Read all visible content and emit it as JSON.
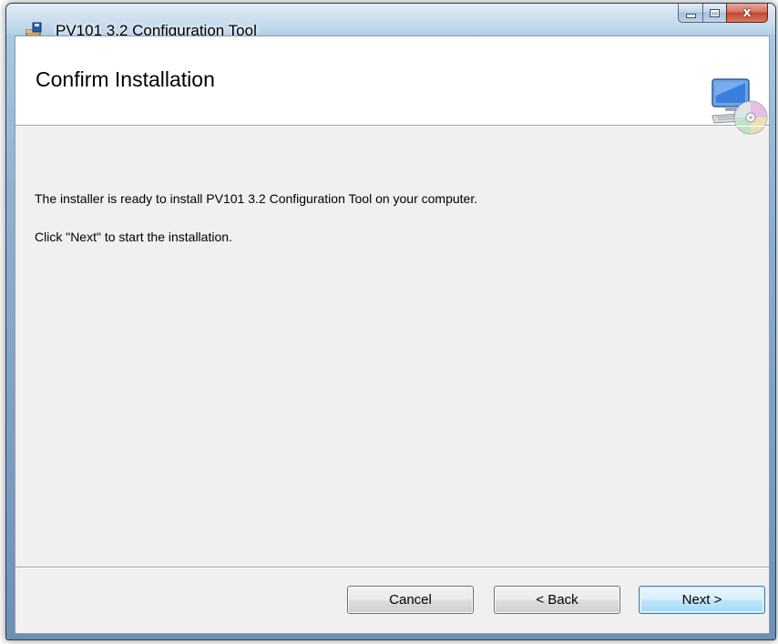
{
  "window": {
    "title": "PV101 3.2 Configuration Tool",
    "caption": {
      "minimize_icon": "minimize-icon",
      "maximize_icon": "maximize-icon",
      "close_glyph": "x"
    }
  },
  "banner": {
    "title": "Confirm Installation",
    "icon": "computer-cd-icon"
  },
  "content": {
    "line1": "The installer is ready to install PV101 3.2 Configuration Tool on your computer.",
    "line2": "Click \"Next\" to start the installation."
  },
  "buttons": {
    "cancel": "Cancel",
    "back": "< Back",
    "next": "Next >"
  },
  "colors": {
    "accent": "#3c7fb1",
    "close": "#c04530"
  }
}
